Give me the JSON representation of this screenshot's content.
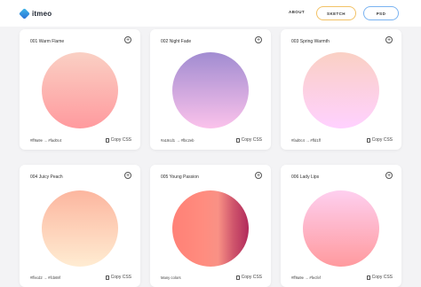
{
  "header": {
    "logo_text": "itmeo",
    "nav_about": "ABOUT",
    "nav_sketch": "SKETCH",
    "nav_psd": "PSD"
  },
  "cards": [
    {
      "title": "001 Warm Flame",
      "colors": "#ff9a9e → #fad0c4",
      "copy": "Copy CSS",
      "gradient": [
        "#ff9a9e",
        "#fad0c4"
      ]
    },
    {
      "title": "002 Night Fade",
      "colors": "#a18cd1 → #fbc2eb",
      "copy": "Copy CSS",
      "gradient": [
        "#fbc2eb",
        "#a18cd1"
      ]
    },
    {
      "title": "003 Spring Warmth",
      "colors": "#fad0c4 → #ffd1ff",
      "copy": "Copy CSS",
      "gradient": [
        "#ffd1ff",
        "#fad0c4"
      ]
    },
    {
      "title": "004 Juicy Peach",
      "colors": "#ffecd2 → #fcb69f",
      "copy": "Copy CSS",
      "gradient": [
        "#ffecd2",
        "#fcb69f"
      ]
    },
    {
      "title": "005 Young Passion",
      "colors": "Many colors",
      "copy": "Copy CSS",
      "gradient": [
        "#ff8177",
        "#ff867a",
        "#ff8c7f",
        "#f99185",
        "#cf556c",
        "#b12a5b"
      ]
    },
    {
      "title": "006 Lady Lips",
      "colors": "#ff9a9e → #fecfef",
      "copy": "Copy CSS",
      "gradient": [
        "#ff9a9e",
        "#fecfef"
      ]
    }
  ]
}
